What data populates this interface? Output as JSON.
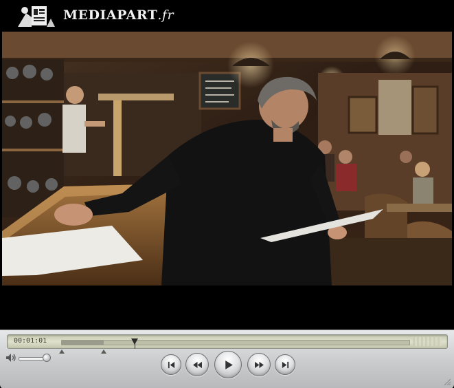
{
  "app": {
    "logo_text": "MEDIAPART",
    "logo_ext": ".fr"
  },
  "player": {
    "timecode": "00:01:01",
    "playhead_fraction": 0.21,
    "loaded_fraction": 0.12,
    "volume_fraction": 0.95,
    "buttons": [
      {
        "name": "skip-to-start-button",
        "icon": "skip-start-icon"
      },
      {
        "name": "rewind-button",
        "icon": "rewind-icon"
      },
      {
        "name": "play-button",
        "icon": "play-icon"
      },
      {
        "name": "fast-forward-button",
        "icon": "fast-forward-icon"
      },
      {
        "name": "skip-to-end-button",
        "icon": "skip-end-icon"
      }
    ]
  },
  "colors": {
    "control_bar": "#c9cbcc",
    "timeline": "#dfe1cc",
    "background": "#000000"
  }
}
